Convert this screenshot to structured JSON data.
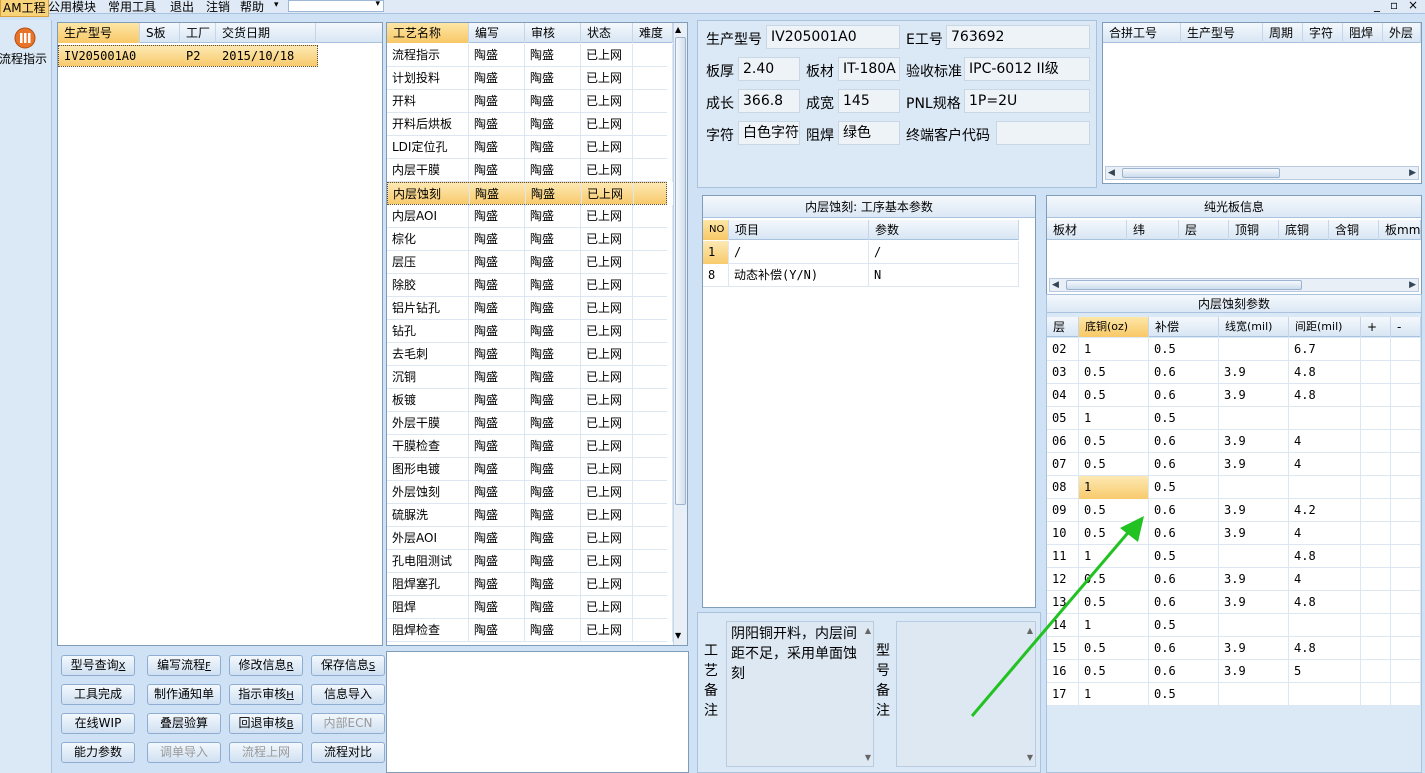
{
  "menubar": {
    "items": [
      "AM工程",
      "公用模块",
      "常用工具",
      "退出",
      "注销",
      "帮助"
    ],
    "controls": [
      "_",
      "▫",
      "×"
    ]
  },
  "nav": {
    "flow_label": "流程指示",
    "flow_icon": "flow-indicator-icon"
  },
  "order_list": {
    "headers": [
      "生产型号",
      "S板",
      "工厂",
      "交货日期"
    ],
    "rows": [
      [
        "IV205001A0",
        "",
        "P2",
        "2015/10/18"
      ]
    ]
  },
  "process_list": {
    "headers": [
      "工艺名称",
      "编写",
      "审核",
      "状态",
      "难度"
    ],
    "rows": [
      [
        "流程指示",
        "陶盛",
        "陶盛",
        "已上网",
        ""
      ],
      [
        "计划投料",
        "陶盛",
        "陶盛",
        "已上网",
        ""
      ],
      [
        "开料",
        "陶盛",
        "陶盛",
        "已上网",
        ""
      ],
      [
        "开料后烘板",
        "陶盛",
        "陶盛",
        "已上网",
        ""
      ],
      [
        "LDI定位孔",
        "陶盛",
        "陶盛",
        "已上网",
        ""
      ],
      [
        "内层干膜",
        "陶盛",
        "陶盛",
        "已上网",
        ""
      ],
      [
        "内层蚀刻",
        "陶盛",
        "陶盛",
        "已上网",
        ""
      ],
      [
        "内层AOI",
        "陶盛",
        "陶盛",
        "已上网",
        ""
      ],
      [
        "棕化",
        "陶盛",
        "陶盛",
        "已上网",
        ""
      ],
      [
        "层压",
        "陶盛",
        "陶盛",
        "已上网",
        ""
      ],
      [
        "除胶",
        "陶盛",
        "陶盛",
        "已上网",
        ""
      ],
      [
        "铝片钻孔",
        "陶盛",
        "陶盛",
        "已上网",
        ""
      ],
      [
        "钻孔",
        "陶盛",
        "陶盛",
        "已上网",
        ""
      ],
      [
        "去毛刺",
        "陶盛",
        "陶盛",
        "已上网",
        ""
      ],
      [
        "沉铜",
        "陶盛",
        "陶盛",
        "已上网",
        ""
      ],
      [
        "板镀",
        "陶盛",
        "陶盛",
        "已上网",
        ""
      ],
      [
        "外层干膜",
        "陶盛",
        "陶盛",
        "已上网",
        ""
      ],
      [
        "干膜检查",
        "陶盛",
        "陶盛",
        "已上网",
        ""
      ],
      [
        "图形电镀",
        "陶盛",
        "陶盛",
        "已上网",
        ""
      ],
      [
        "外层蚀刻",
        "陶盛",
        "陶盛",
        "已上网",
        ""
      ],
      [
        "硫脲洗",
        "陶盛",
        "陶盛",
        "已上网",
        ""
      ],
      [
        "外层AOI",
        "陶盛",
        "陶盛",
        "已上网",
        ""
      ],
      [
        "孔电阻测试",
        "陶盛",
        "陶盛",
        "已上网",
        ""
      ],
      [
        "阻焊塞孔",
        "陶盛",
        "陶盛",
        "已上网",
        ""
      ],
      [
        "阻焊",
        "陶盛",
        "陶盛",
        "已上网",
        ""
      ],
      [
        "阻焊检查",
        "陶盛",
        "陶盛",
        "已上网",
        ""
      ]
    ]
  },
  "buttons": [
    [
      "型号查询",
      "X"
    ],
    [
      "编写流程",
      "F"
    ],
    [
      "修改信息",
      "R"
    ],
    [
      "保存信息",
      "S"
    ],
    [
      "工具完成",
      ""
    ],
    [
      "制作通知单",
      ""
    ],
    [
      "指示审核",
      "H"
    ],
    [
      "信息导入",
      ""
    ],
    [
      "在线WIP",
      ""
    ],
    [
      "叠层验算",
      ""
    ],
    [
      "回退审核",
      "B"
    ],
    [
      "内部ECN",
      ""
    ],
    [
      "能力参数",
      ""
    ],
    [
      "调单导入",
      ""
    ],
    [
      "流程上网",
      ""
    ],
    [
      "流程对比",
      ""
    ]
  ],
  "info": {
    "model_label": "生产型号",
    "model_value": "IV205001A0",
    "e_label": "E工号",
    "e_value": "763692",
    "thick_label": "板厚",
    "thick_value": "2.40",
    "material_label": "板材",
    "material_value": "IT-180A",
    "std_label": "验收标准",
    "std_value": "IPC-6012 II级",
    "len_label": "成长",
    "len_value": "366.8",
    "wid_label": "成宽",
    "wid_value": "145",
    "pnl_label": "PNL规格",
    "pnl_value": "1P=2U",
    "char_label": "字符",
    "char_value": "白色字符",
    "mask_label": "阻焊",
    "mask_value": "绿色",
    "cust_label": "终端客户代码",
    "cust_value": ""
  },
  "merge_table": {
    "headers": [
      "合拼工号",
      "生产型号",
      "周期",
      "字符",
      "阻焊",
      "外层"
    ]
  },
  "basic_params": {
    "title": "内层蚀刻: 工序基本参数",
    "headers": [
      "NO",
      "项目",
      "参数"
    ],
    "rows": [
      [
        "1",
        "/",
        "/"
      ],
      [
        "8",
        "动态补偿(Y/N)",
        "N"
      ]
    ]
  },
  "bare_board": {
    "title": "纯光板信息",
    "headers": [
      "板材",
      "纬",
      "层",
      "顶铜",
      "底铜",
      "含铜",
      "板mm"
    ]
  },
  "etch_params": {
    "title": "内层蚀刻参数",
    "headers": [
      "层",
      "底铜(oz)",
      "补偿",
      "线宽(mil)",
      "间距(mil)",
      "+",
      "-"
    ],
    "rows": [
      [
        "02",
        "1",
        "0.5",
        "",
        "6.7"
      ],
      [
        "03",
        "0.5",
        "0.6",
        "3.9",
        "4.8"
      ],
      [
        "04",
        "0.5",
        "0.6",
        "3.9",
        "4.8"
      ],
      [
        "05",
        "1",
        "0.5",
        "",
        ""
      ],
      [
        "06",
        "0.5",
        "0.6",
        "3.9",
        "4"
      ],
      [
        "07",
        "0.5",
        "0.6",
        "3.9",
        "4"
      ],
      [
        "08",
        "1",
        "0.5",
        "",
        ""
      ],
      [
        "09",
        "0.5",
        "0.6",
        "3.9",
        "4.2"
      ],
      [
        "10",
        "0.5",
        "0.6",
        "3.9",
        "4"
      ],
      [
        "11",
        "1",
        "0.5",
        "",
        "4.8"
      ],
      [
        "12",
        "0.5",
        "0.6",
        "3.9",
        "4"
      ],
      [
        "13",
        "0.5",
        "0.6",
        "3.9",
        "4.8"
      ],
      [
        "14",
        "1",
        "0.5",
        "",
        ""
      ],
      [
        "15",
        "0.5",
        "0.6",
        "3.9",
        "4.8"
      ],
      [
        "16",
        "0.5",
        "0.6",
        "3.9",
        "5"
      ],
      [
        "17",
        "1",
        "0.5",
        "",
        ""
      ]
    ]
  },
  "remarks": {
    "process_label": "工艺备注",
    "process_text": "阴阳铜开料，内层间距不足，采用单面蚀刻",
    "model_label": "型号备注",
    "model_text": ""
  },
  "colors": {
    "accent": "#f8ca6c",
    "arrow": "#22c222",
    "panel_bg": "#cfe2f5"
  }
}
